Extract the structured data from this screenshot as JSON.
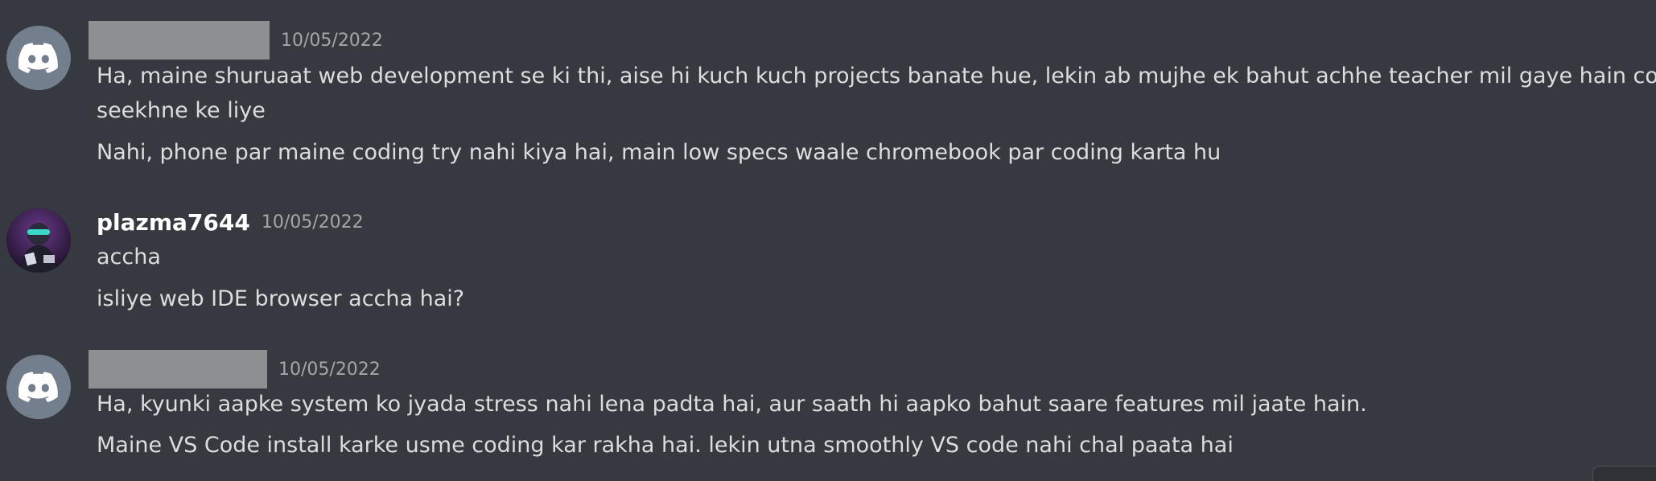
{
  "messages": [
    {
      "author": "",
      "author_redacted": true,
      "avatar": "discord-logo-icon",
      "timestamp": "10/05/2022",
      "lines": [
        "Ha, maine shuruaat web development se ki thi, aise hi kuch kuch  projects banate hue, lekin ab mujhe ek bahut achhe teacher mil gaye hain coding",
        "seekhne ke liye",
        "Nahi, phone par maine coding try nahi kiya hai, main low specs waale chromebook par coding karta hu"
      ]
    },
    {
      "author": "plazma7644",
      "author_redacted": false,
      "avatar": "user-avatar",
      "timestamp": "10/05/2022",
      "lines": [
        "accha",
        "isliye web IDE browser accha hai?"
      ]
    },
    {
      "author": "",
      "author_redacted": true,
      "avatar": "discord-logo-icon",
      "timestamp": "10/05/2022",
      "lines": [
        "Ha, kyunki aapke system ko jyada stress nahi lena padta hai, aur saath hi aapko bahut saare features mil jaate hain.",
        "Maine VS Code install karke usme coding kar rakha hai. lekin utna smoothly VS code nahi chal paata hai"
      ]
    }
  ],
  "colors": {
    "background": "#36393f",
    "message_text": "#dcddde",
    "timestamp": "#a3a6aa",
    "username": "#ffffff",
    "discord_avatar_bg": "#747f8d",
    "redaction": "#8e8f91"
  }
}
